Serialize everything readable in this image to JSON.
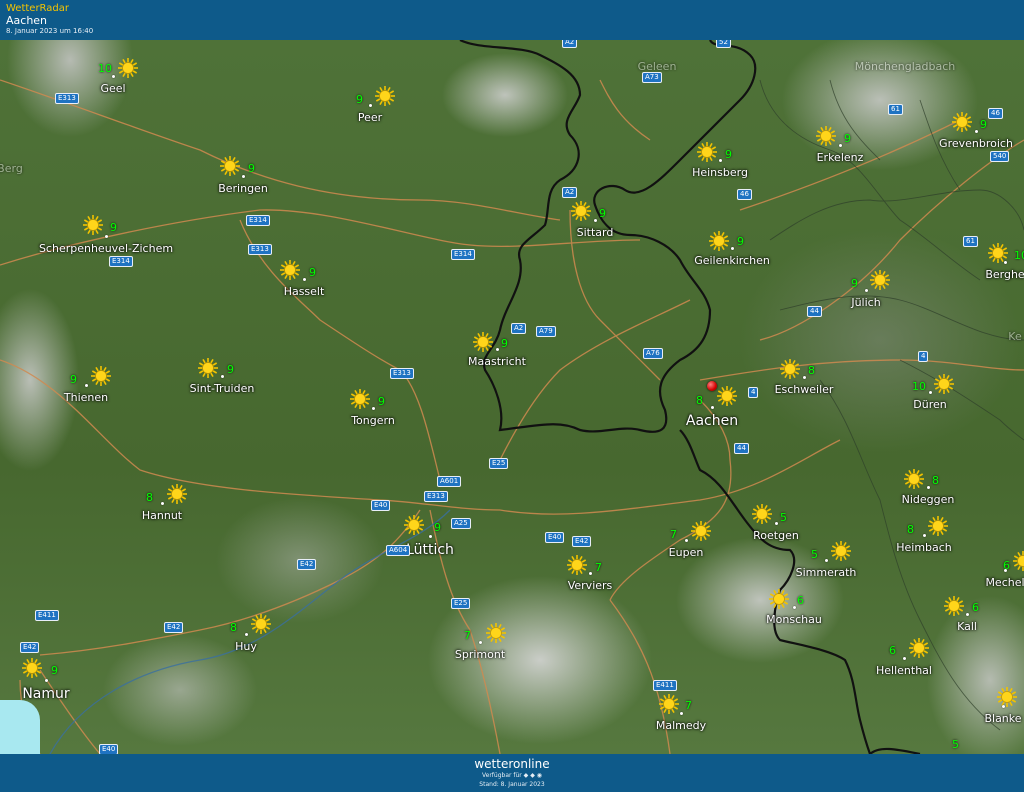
{
  "header": {
    "app_name": "WetterRadar",
    "location": "Aachen",
    "date": "8. Januar 2023 um 16:40"
  },
  "footer": {
    "brand": "wetteronline",
    "available": "Verfügbar für",
    "stand": "Stand: 8. Januar 2023"
  },
  "colors": {
    "header_bg": "#0e5a8a",
    "app_name": "#f5c400",
    "temp": "#00ff00",
    "border": "#111111",
    "road": "#d08a50",
    "road_badge": "#1f73c2",
    "marker": "#d10000"
  },
  "map": {
    "places": [
      {
        "name": "Geel",
        "temp": "10",
        "icon": "sun-icon"
      },
      {
        "name": "Peer",
        "temp": "9",
        "icon": "sun-icon"
      },
      {
        "name": "Beringen",
        "temp": "9",
        "icon": "sun-icon"
      },
      {
        "name": "Scherpenheuvel-Zichem",
        "temp": "9",
        "icon": "sun-icon"
      },
      {
        "name": "Hasselt",
        "temp": "9",
        "icon": "sun-icon"
      },
      {
        "name": "Thienen",
        "temp": "9",
        "icon": "sun-icon"
      },
      {
        "name": "Sint-Truiden",
        "temp": "9",
        "icon": "sun-icon"
      },
      {
        "name": "Tongern",
        "temp": "9",
        "icon": "sun-icon"
      },
      {
        "name": "Maastricht",
        "temp": "9",
        "icon": "sun-icon"
      },
      {
        "name": "Sittard",
        "temp": "9",
        "icon": "sun-icon"
      },
      {
        "name": "Heinsberg",
        "temp": "9",
        "icon": "sun-icon"
      },
      {
        "name": "Erkelenz",
        "temp": "9",
        "icon": "sun-icon"
      },
      {
        "name": "Grevenbroich",
        "temp": "9",
        "icon": "sun-icon"
      },
      {
        "name": "Geilenkirchen",
        "temp": "9",
        "icon": "sun-icon"
      },
      {
        "name": "Jülich",
        "temp": "9",
        "icon": "sun-icon"
      },
      {
        "name": "Berghe",
        "temp": "10",
        "icon": "sun-icon"
      },
      {
        "name": "Eschweiler",
        "temp": "8",
        "icon": "sun-icon"
      },
      {
        "name": "Düren",
        "temp": "10",
        "icon": "sun-icon"
      },
      {
        "name": "Aachen",
        "temp": "8",
        "icon": "sun-icon"
      },
      {
        "name": "Hannut",
        "temp": "8",
        "icon": "sun-icon"
      },
      {
        "name": "Lüttich",
        "temp": "9",
        "icon": "sun-icon"
      },
      {
        "name": "Eupen",
        "temp": "7",
        "icon": "sun-icon"
      },
      {
        "name": "Roetgen",
        "temp": "5",
        "icon": "sun-icon"
      },
      {
        "name": "Nideggen",
        "temp": "8",
        "icon": "sun-icon"
      },
      {
        "name": "Heimbach",
        "temp": "8",
        "icon": "sun-icon"
      },
      {
        "name": "Verviers",
        "temp": "7",
        "icon": "sun-icon"
      },
      {
        "name": "Simmerath",
        "temp": "5",
        "icon": "sun-icon"
      },
      {
        "name": "Monschau",
        "temp": "6",
        "icon": "sun-icon"
      },
      {
        "name": "Mechel",
        "temp": "6",
        "icon": "sun-icon"
      },
      {
        "name": "Kall",
        "temp": "6",
        "icon": "sun-icon"
      },
      {
        "name": "Huy",
        "temp": "8",
        "icon": "sun-icon"
      },
      {
        "name": "Sprimont",
        "temp": "7",
        "icon": "sun-icon"
      },
      {
        "name": "Hellenthal",
        "temp": "6",
        "icon": "sun-icon"
      },
      {
        "name": "Namur",
        "temp": "9",
        "icon": "sun-icon"
      },
      {
        "name": "Malmedy",
        "temp": "7",
        "icon": "sun-icon"
      },
      {
        "name": "Blanke",
        "temp": "",
        "icon": "sun-icon"
      }
    ],
    "faded_labels": [
      "Geleen",
      "Mönchengladbach",
      "Berg",
      "Ke"
    ],
    "roads": [
      "A2",
      "A73",
      "52",
      "E313",
      "E314",
      "E314",
      "E313",
      "E314",
      "A2",
      "A2",
      "A79",
      "A76",
      "E313",
      "46",
      "46",
      "540",
      "61",
      "61",
      "44",
      "4",
      "4",
      "44",
      "E25",
      "A601",
      "E313",
      "E40",
      "A25",
      "A604",
      "E40",
      "E42",
      "E42",
      "E25",
      "E411",
      "E42",
      "E42",
      "E411",
      "E40"
    ],
    "extra_temps": [
      "5"
    ]
  }
}
